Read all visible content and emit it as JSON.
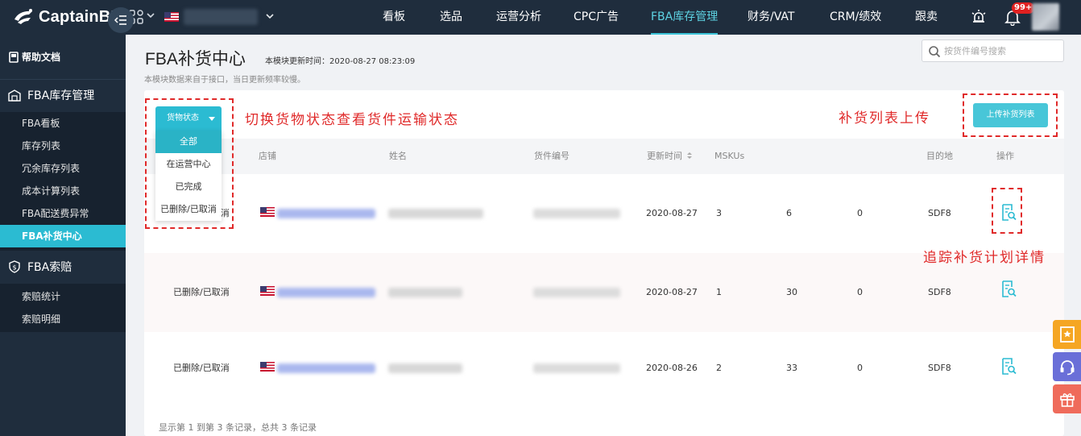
{
  "header": {
    "logo_text": "CaptainBI",
    "nav": [
      "看板",
      "选品",
      "运营分析",
      "CPC广告",
      "FBA库存管理",
      "财务/VAT",
      "CRM/绩效",
      "跟卖"
    ],
    "active_nav": "FBA库存管理",
    "notification_count": "99+"
  },
  "sidebar": {
    "help_label": "帮助文档",
    "section1": {
      "label": "FBA库存管理",
      "items": [
        "FBA看板",
        "库存列表",
        "冗余库存列表",
        "成本计算列表",
        "FBA配送费异常",
        "FBA补货中心"
      ]
    },
    "active_item": "FBA补货中心",
    "section2": {
      "label": "FBA索赔",
      "items": [
        "索赔统计",
        "索赔明细"
      ]
    }
  },
  "page": {
    "title": "FBA补货中心",
    "update_time": "本模块更新时间：2020-08-27 08:23:09",
    "subtitle": "本模块数据来自于接口，当日更新频率较慢。",
    "search_placeholder": "按货件编号搜索"
  },
  "toolbar": {
    "status_button": "货物状态",
    "status_options": [
      "全部",
      "在运营中心",
      "已完成",
      "已删除/已取消"
    ],
    "selected_status": "全部",
    "upload_button": "上传补货列表"
  },
  "table": {
    "columns": [
      "店铺",
      "姓名",
      "货件编号",
      "更新时间",
      "MSKUs",
      "目的地",
      "操作"
    ],
    "rows": [
      {
        "status": "已删除/已取消",
        "date": "2020-08-27",
        "mskus": "3",
        "qty": "6",
        "received": "0",
        "dest": "SDF8"
      },
      {
        "status": "已删除/已取消",
        "date": "2020-08-27",
        "mskus": "1",
        "qty": "30",
        "received": "0",
        "dest": "SDF8"
      },
      {
        "status": "已删除/已取消",
        "date": "2020-08-26",
        "mskus": "2",
        "qty": "33",
        "received": "0",
        "dest": "SDF8"
      }
    ],
    "footer": "显示第 1 到第 3 条记录，总共 3 条记录"
  },
  "annotations": {
    "status_hint": "切换货物状态查看货件运输状态",
    "upload_hint": "补货列表上传",
    "detail_hint": "追踪补货计划详情"
  },
  "colors": {
    "accent": "#2bbbd2",
    "annotation": "#e02a2a",
    "sidebar_bg": "#1f2d3d"
  }
}
